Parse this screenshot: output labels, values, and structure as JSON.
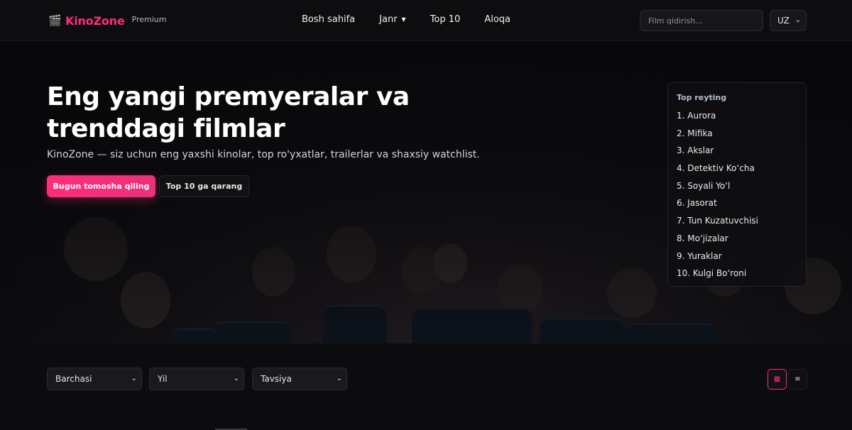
{
  "header": {
    "logo_icon": "clapperboard-icon",
    "brand": "KinoZone",
    "badge": "Premium",
    "nav": [
      {
        "label": "Bosh sahifa"
      },
      {
        "label": "Janr",
        "has_dropdown": true
      },
      {
        "label": "Top 10"
      },
      {
        "label": "Aloqa"
      }
    ],
    "search_placeholder": "Film qidirish...",
    "language": "UZ",
    "accent_color": "#ff2d7a"
  },
  "hero": {
    "title": "Eng yangi premyeralar va trenddagi filmlar",
    "subtitle": "KinoZone — siz uchun eng yaxshi kinolar, top ro'yxatlar, trailerlar va shaxsiy watchlist.",
    "primary_button": "Bugun tomosha qiling",
    "secondary_button": "Top 10 ga qarang"
  },
  "top_rating": {
    "title": "Top reyting",
    "items": [
      "1. Aurora",
      "2. Mifika",
      "3. Akslar",
      "4. Detektiv Ko‘cha",
      "5. Soyali Yo‘l",
      "6. Jasorat",
      "7. Tun Kuzatuvchisi",
      "8. Mo‘jizalar",
      "9. Yuraklar",
      "10. Kulgi Bo‘roni"
    ]
  },
  "filters": {
    "category": "Barchasi",
    "year": "Yil",
    "sort": "Tavsiya",
    "view_grid_icon": "grid-view-icon",
    "view_list_icon": "list-view-icon"
  }
}
